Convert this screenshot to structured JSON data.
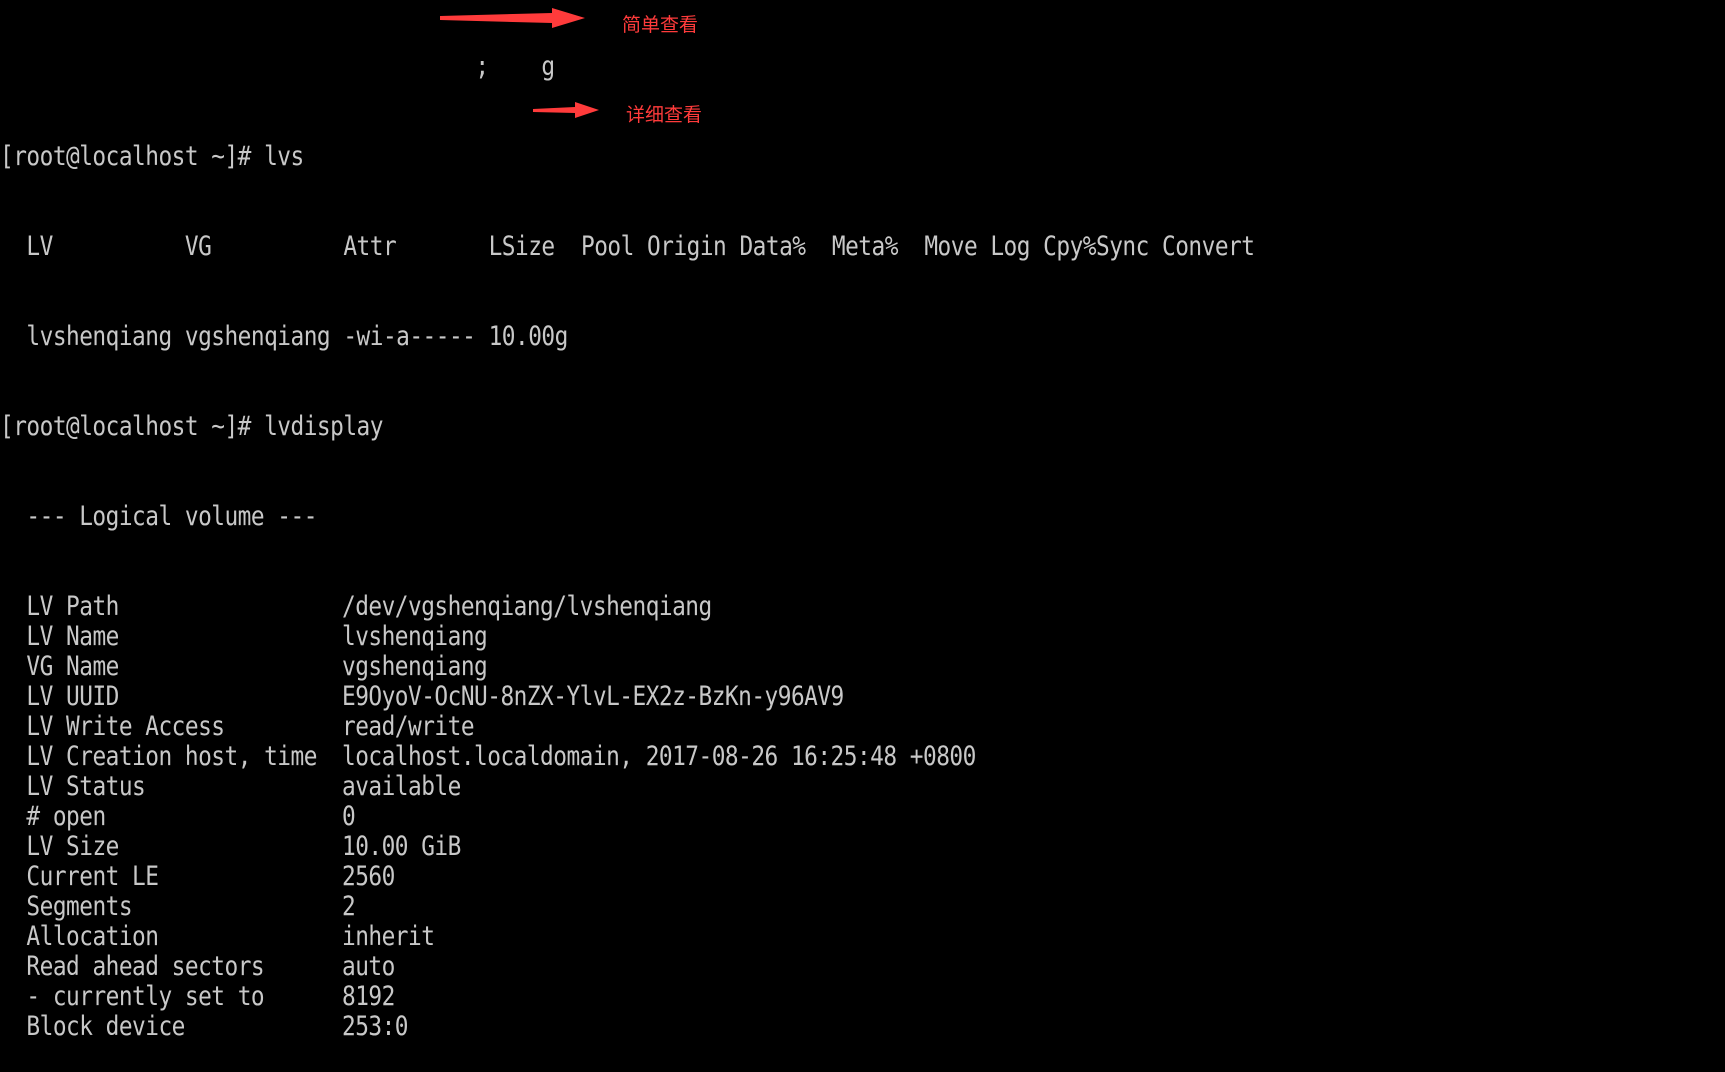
{
  "terminal": {
    "prompt": "[root@localhost ~]# ",
    "partial_top_line": "                                    ;    g",
    "cmd1": "lvs",
    "lvs_header": "  LV          VG          Attr       LSize  Pool Origin Data%  Meta%  Move Log Cpy%Sync Convert",
    "lvs_row": "  lvshenqiang vgshenqiang -wi-a----- 10.00g",
    "cmd2": "lvdisplay",
    "lvdisplay_title": "  --- Logical volume ---",
    "fields": [
      {
        "key": "LV Path",
        "value": "/dev/vgshenqiang/lvshenqiang"
      },
      {
        "key": "LV Name",
        "value": "lvshenqiang"
      },
      {
        "key": "VG Name",
        "value": "vgshenqiang"
      },
      {
        "key": "LV UUID",
        "value": "E9OyoV-OcNU-8nZX-YlvL-EX2z-BzKn-y96AV9"
      },
      {
        "key": "LV Write Access",
        "value": "read/write"
      },
      {
        "key": "LV Creation host, time",
        "value": "localhost.localdomain, 2017-08-26 16:25:48 +0800"
      },
      {
        "key": "LV Status",
        "value": "available"
      },
      {
        "key": "# open",
        "value": "0"
      },
      {
        "key": "LV Size",
        "value": "10.00 GiB"
      },
      {
        "key": "Current LE",
        "value": "2560"
      },
      {
        "key": "Segments",
        "value": "2"
      },
      {
        "key": "Allocation",
        "value": "inherit"
      },
      {
        "key": "Read ahead sectors",
        "value": "auto"
      },
      {
        "key": "- currently set to",
        "value": "8192"
      },
      {
        "key": "Block device",
        "value": "253:0"
      }
    ]
  },
  "annotations": {
    "simple_view": "简单查看",
    "detailed_view": "详细查看",
    "color": "#ff3b3b"
  }
}
